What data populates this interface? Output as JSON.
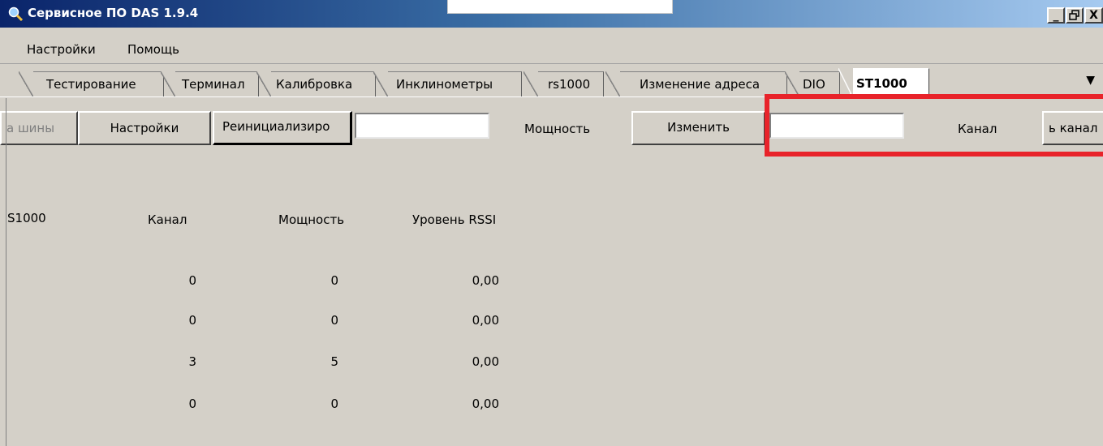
{
  "window": {
    "title": "Сервисное ПО DAS 1.9.4",
    "controls": {
      "minimize": "_",
      "maximize": "🗗",
      "close": "X"
    }
  },
  "menu": [
    "Настройки",
    "Помощь"
  ],
  "tabs": [
    "Тестирование",
    "Терминал",
    "Калибровка",
    "Инклинометры",
    "rs1000",
    "Изменение адреса",
    "DIO",
    "ST1000"
  ],
  "active_tab": "ST1000",
  "tab_dropdown": "▼",
  "toolbar": {
    "bus_button": "а шины",
    "settings_button": "Настройки",
    "reinit_button": "Реинициализиро",
    "power_input": "",
    "power_label": "Мощность",
    "change_button": "Изменить",
    "channel_input": "",
    "channel_label": "Канал",
    "change_channel_button": "ь канал"
  },
  "table": {
    "headers": [
      "S1000",
      "Канал",
      "Мощность",
      "Уровень RSSI"
    ],
    "rows": [
      {
        "channel": "0",
        "power": "0",
        "rssi": "0,00"
      },
      {
        "channel": "0",
        "power": "0",
        "rssi": "0,00"
      },
      {
        "channel": "3",
        "power": "5",
        "rssi": "0,00"
      },
      {
        "channel": "0",
        "power": "0",
        "rssi": "0,00"
      }
    ]
  },
  "colors": {
    "highlight": "#e8232a",
    "titlebar": "#0a246a",
    "face": "#d4d0c8"
  }
}
